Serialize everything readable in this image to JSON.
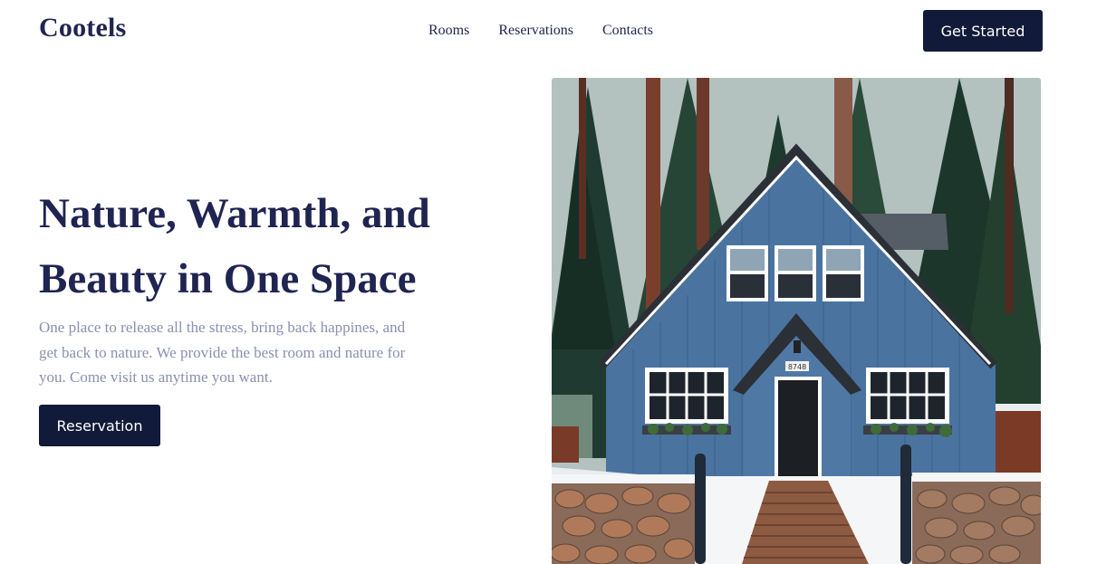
{
  "header": {
    "logo": "Cootels",
    "nav": [
      "Rooms",
      "Reservations",
      "Contacts"
    ],
    "cta_label": "Get Started"
  },
  "hero": {
    "title_line1": "Nature, Warmth, and",
    "title_line2": "Beauty in One Space",
    "description": "One place to release all the stress, bring back happines, and get back to nature. We provide the best room and nature for you. Come visit us anytime you want.",
    "button_label": "Reservation",
    "image_house_number": "8748"
  },
  "colors": {
    "brand": "#1f2451",
    "button_bg": "#111a38",
    "text_muted": "#8a90b0",
    "house_blue": "#4a73a0"
  }
}
